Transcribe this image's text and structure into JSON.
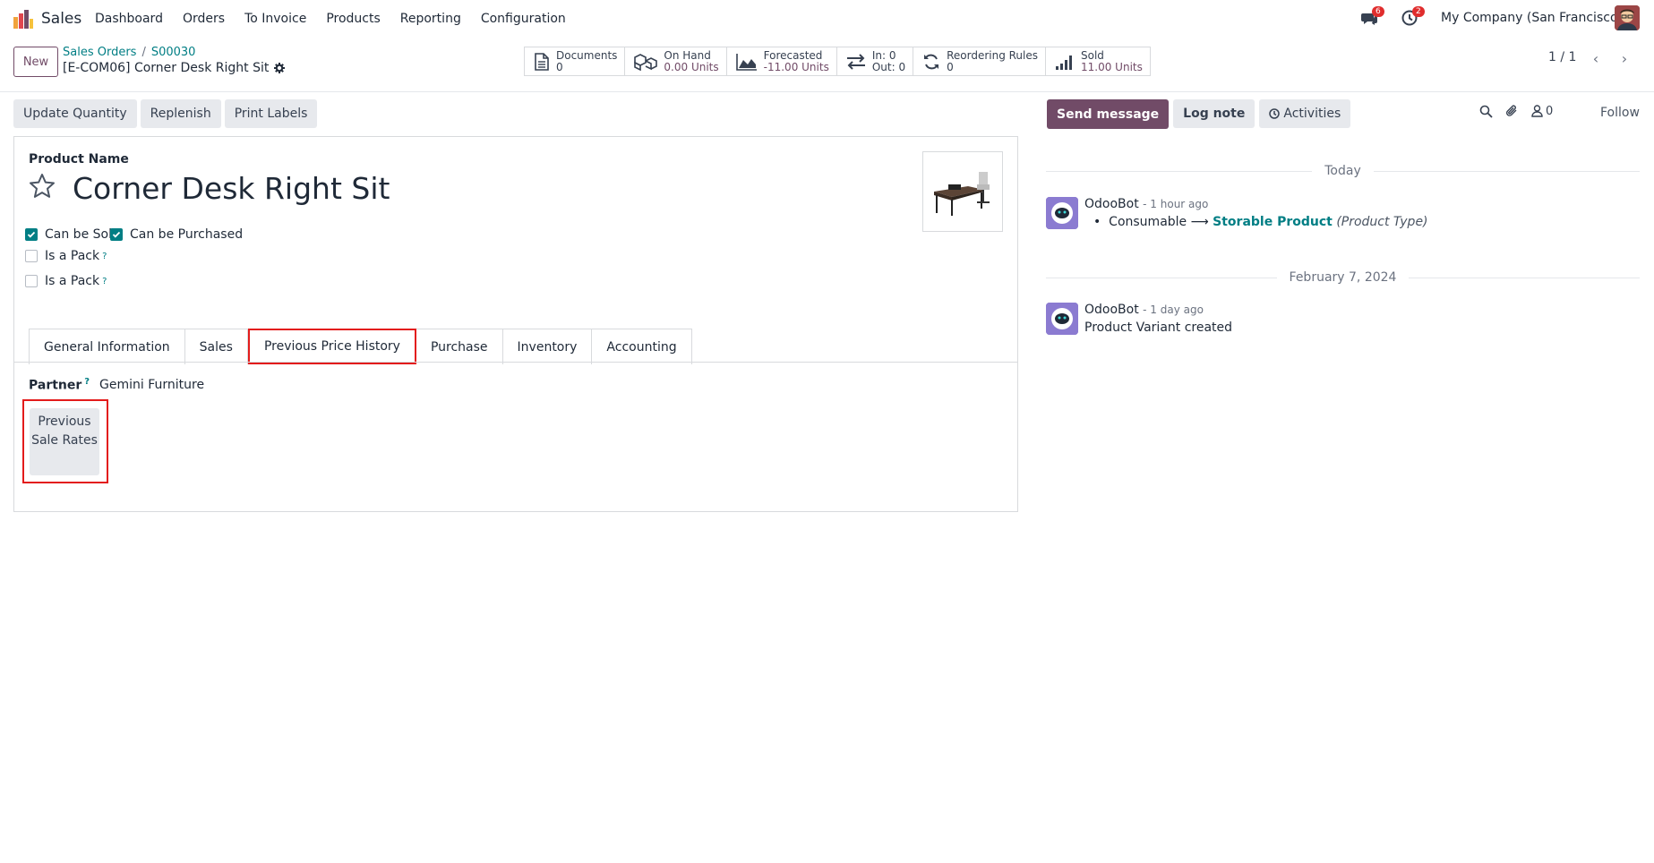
{
  "app": {
    "name": "Sales"
  },
  "menu": [
    "Dashboard",
    "Orders",
    "To Invoice",
    "Products",
    "Reporting",
    "Configuration"
  ],
  "systray": {
    "messages_count": "6",
    "activities_count": "2",
    "company": "My Company (San Francisco)"
  },
  "control": {
    "new_label": "New",
    "breadcrumb": [
      "Sales Orders",
      "S00030"
    ],
    "record_title": "[E-COM06] Corner Desk Right Sit",
    "pager": "1 / 1"
  },
  "smart_buttons": [
    {
      "title": "Documents",
      "value": "0",
      "icon": "document-icon"
    },
    {
      "title": "On Hand",
      "value": "0.00 Units",
      "icon": "cubes-icon"
    },
    {
      "title": "Forecasted",
      "value": "-11.00 Units",
      "icon": "area-chart-icon"
    },
    {
      "title": "In: 0",
      "value": "Out: 0",
      "icon": "exchange-icon"
    },
    {
      "title": "Reordering Rules",
      "value": "0",
      "icon": "refresh-icon"
    },
    {
      "title": "Sold",
      "value": "11.00 Units",
      "icon": "signal-icon"
    }
  ],
  "actions": [
    "Update Quantity",
    "Replenish",
    "Print Labels"
  ],
  "form": {
    "product_name_label": "Product Name",
    "product_name": "Corner Desk Right Sit",
    "checkboxes": [
      {
        "label": "Can be Sold",
        "checked": true
      },
      {
        "label": "Can be Purchased",
        "checked": true
      },
      {
        "label": "Is a Pack",
        "checked": false
      },
      {
        "label": "Is a Pack",
        "checked": false
      }
    ],
    "tabs": [
      "General Information",
      "Sales",
      "Previous Price History",
      "Purchase",
      "Inventory",
      "Accounting"
    ],
    "active_tab": "Previous Price History",
    "partner_label": "Partner",
    "partner_value": "Gemini Furniture",
    "previous_rates_button": "Previous Sale Rates",
    "help_mark": "?"
  },
  "chatter": {
    "send_message": "Send message",
    "log_note": "Log note",
    "activities": "Activities",
    "followers_count": "0",
    "follow": "Follow",
    "groups": [
      {
        "date": "Today",
        "author": "OdooBot",
        "time": "- 1 hour ago",
        "old_value": "Consumable",
        "new_value": "Storable Product",
        "field": "(Product Type)"
      },
      {
        "date": "February 7, 2024",
        "author": "OdooBot",
        "time": "- 1 day ago",
        "body": "Product Variant created"
      }
    ]
  },
  "colors": {
    "brand": "#714b67",
    "link": "#017e84",
    "highlight": "#e31b1b"
  }
}
